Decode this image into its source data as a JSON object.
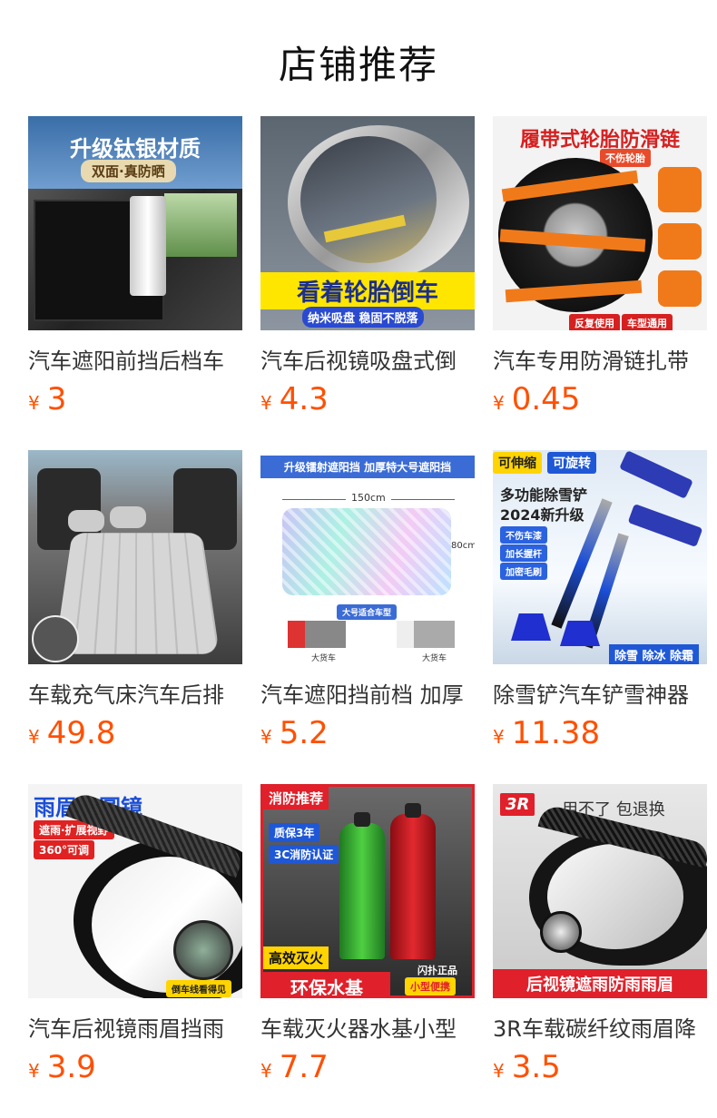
{
  "title": "店铺推荐",
  "currency": "¥",
  "products": [
    {
      "name": "汽车遮阳前挡后档车",
      "price": "3",
      "image_text": [
        "升级钛银材质",
        "双面·真防晒"
      ]
    },
    {
      "name": "汽车后视镜吸盘式倒",
      "price": "4.3",
      "image_text": [
        "看着轮胎倒车",
        "纳米吸盘 稳固不脱落"
      ]
    },
    {
      "name": "汽车专用防滑链扎带",
      "price": "0.45",
      "image_text": [
        "履带式轮胎防滑链",
        "不伤轮胎",
        "反复使用",
        "车型通用"
      ]
    },
    {
      "name": "车载充气床汽车后排",
      "price": "49.8",
      "image_text": []
    },
    {
      "name": "汽车遮阳挡前档 加厚",
      "price": "5.2",
      "image_text": [
        "升级镭射遮阳挡 加厚特大号遮阳挡",
        "150cm",
        "80cm",
        "大号适合车型",
        "大货车",
        "大货车"
      ]
    },
    {
      "name": "除雪铲汽车铲雪神器",
      "price": "11.38",
      "image_text": [
        "可伸缩",
        "可旋转",
        "多功能除雪铲",
        "2024新升级",
        "不伤车漆",
        "加长握杆",
        "加密毛刷",
        "除雪 除冰 除霜"
      ]
    },
    {
      "name": "汽车后视镜雨眉挡雨",
      "price": "3.9",
      "image_text": [
        "雨眉小圆镜",
        "遮雨·扩展视野",
        "360°可调",
        "倒车线看得见"
      ]
    },
    {
      "name": "车载灭火器水基小型",
      "price": "7.7",
      "image_text": [
        "消防推荐",
        "质保3年",
        "3C消防认证",
        "高效灭火",
        "环保水基",
        "闪扑正品",
        "小型便携"
      ]
    },
    {
      "name": "3R车载碳纤纹雨眉降",
      "price": "3.5",
      "image_text": [
        "3R",
        "用不了 包退换",
        "后视镜遮雨防雨雨眉"
      ]
    }
  ],
  "colors": {
    "price": "#ff5000",
    "title": "#111111",
    "name": "#333333"
  }
}
